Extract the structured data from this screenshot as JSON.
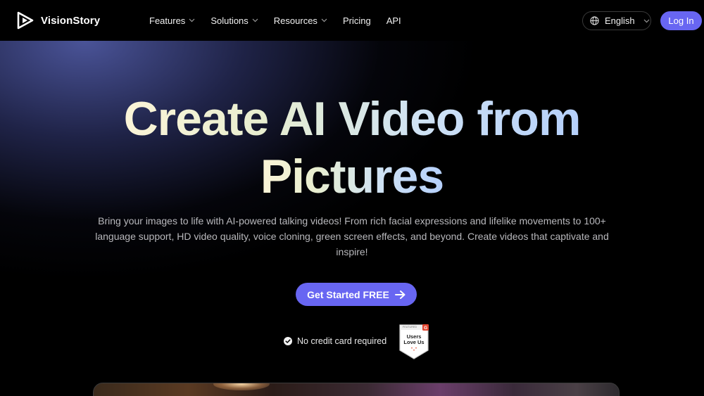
{
  "brand": {
    "name": "VisionStory",
    "logo_icon": "play-triangle-logo-icon"
  },
  "nav": {
    "items": [
      {
        "label": "Features",
        "dropdown": true
      },
      {
        "label": "Solutions",
        "dropdown": true
      },
      {
        "label": "Resources",
        "dropdown": true
      },
      {
        "label": "Pricing",
        "dropdown": false
      },
      {
        "label": "API",
        "dropdown": false
      }
    ],
    "language": {
      "label": "English",
      "icon": "globe-icon"
    },
    "login_label": "Log In"
  },
  "hero": {
    "title_line1": "Create AI Video from",
    "title_line2": "Pictures",
    "subtitle": "Bring your images to life with AI-powered talking videos! From rich facial expressions and lifelike movements to 100+ language support, HD video quality, voice cloning, green screen effects, and beyond. Create videos that captivate and inspire!",
    "cta_label": "Get Started FREE",
    "cta_icon": "arrow-right-icon",
    "note": "No credit card required",
    "badge": {
      "top": "FEATURED",
      "line1": "Users",
      "line2": "Love Us"
    }
  },
  "colors": {
    "accent": "#6866f2",
    "background": "#000000",
    "badge_red": "#e2452f"
  }
}
